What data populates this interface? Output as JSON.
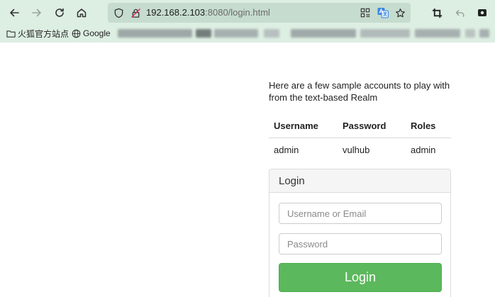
{
  "browser": {
    "url_host": "192.168.2.103",
    "url_rest": ":8080/login.html",
    "bookmarks": [
      {
        "label": "火狐官方站点",
        "icon": "folder-icon"
      },
      {
        "label": "Google",
        "icon": "globe-icon"
      }
    ]
  },
  "intro_text": "Here are a few sample accounts to play with from the text-based Realm",
  "accounts_table": {
    "headers": [
      "Username",
      "Password",
      "Roles"
    ],
    "rows": [
      [
        "admin",
        "vulhub",
        "admin"
      ]
    ]
  },
  "login_panel": {
    "heading": "Login",
    "username_placeholder": "Username or Email",
    "password_placeholder": "Password",
    "button_label": "Login"
  },
  "colors": {
    "chrome_bg": "#ddeee2",
    "urlbar_bg": "#c6dccf",
    "login_button": "#5cb85c"
  }
}
